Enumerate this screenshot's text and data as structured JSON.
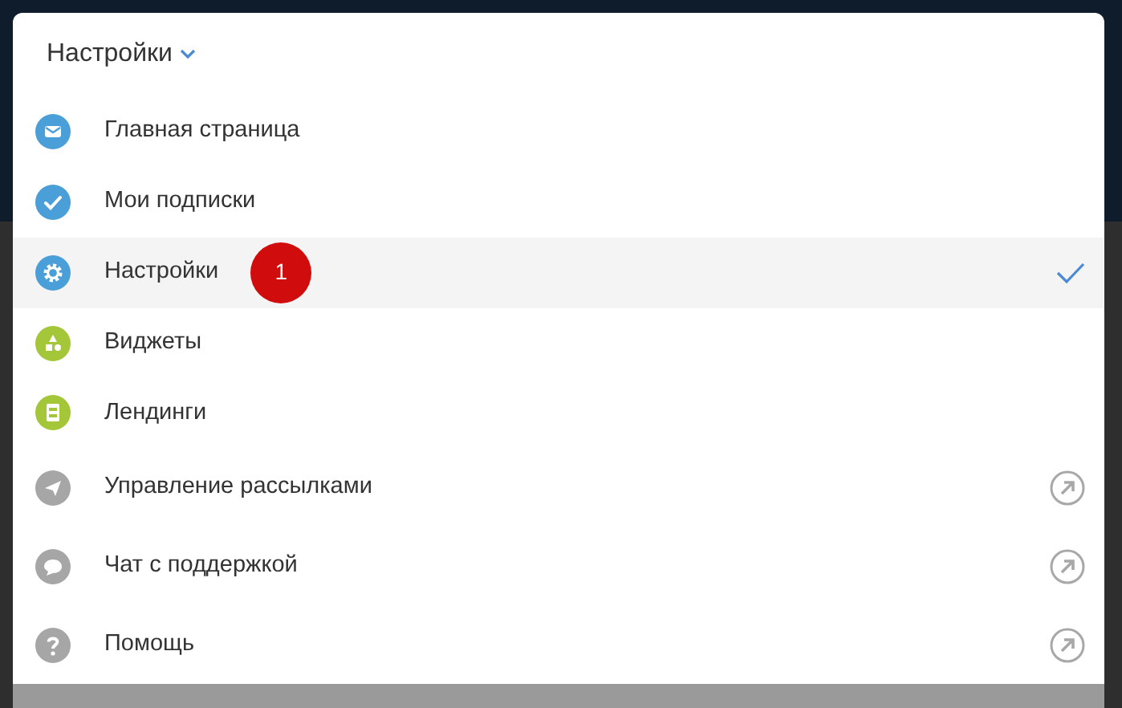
{
  "menu": {
    "title": "Настройки",
    "items": [
      {
        "label": "Главная страница",
        "color": "#4a9fd8",
        "selected": false,
        "kind": "internal"
      },
      {
        "label": "Мои подписки",
        "color": "#4a9fd8",
        "selected": false,
        "kind": "internal"
      },
      {
        "label": "Настройки",
        "color": "#4a9fd8",
        "selected": true,
        "kind": "internal",
        "badge": "1"
      },
      {
        "label": "Виджеты",
        "color": "#a4c639",
        "selected": false,
        "kind": "internal"
      },
      {
        "label": "Лендинги",
        "color": "#a4c639",
        "selected": false,
        "kind": "internal"
      },
      {
        "label": "Управление рассылками",
        "color": "#a6a6a6",
        "selected": false,
        "kind": "external"
      },
      {
        "label": "Чат с поддержкой",
        "color": "#a6a6a6",
        "selected": false,
        "kind": "external"
      },
      {
        "label": "Помощь",
        "color": "#a6a6a6",
        "selected": false,
        "kind": "external"
      }
    ]
  }
}
